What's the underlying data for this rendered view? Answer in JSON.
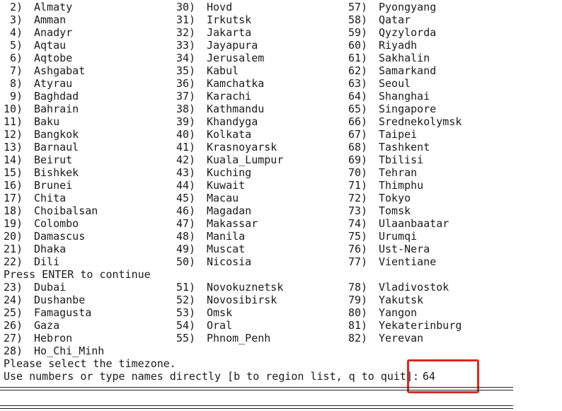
{
  "terminal": {
    "columns": [
      [
        {
          "num": " 2)",
          "name": "Almaty"
        },
        {
          "num": " 3)",
          "name": "Amman"
        },
        {
          "num": " 4)",
          "name": "Anadyr"
        },
        {
          "num": " 5)",
          "name": "Aqtau"
        },
        {
          "num": " 6)",
          "name": "Aqtobe"
        },
        {
          "num": " 7)",
          "name": "Ashgabat"
        },
        {
          "num": " 8)",
          "name": "Atyrau"
        },
        {
          "num": " 9)",
          "name": "Baghdad"
        },
        {
          "num": "10)",
          "name": "Bahrain"
        },
        {
          "num": "11)",
          "name": "Baku"
        },
        {
          "num": "12)",
          "name": "Bangkok"
        },
        {
          "num": "13)",
          "name": "Barnaul"
        },
        {
          "num": "14)",
          "name": "Beirut"
        },
        {
          "num": "15)",
          "name": "Bishkek"
        },
        {
          "num": "16)",
          "name": "Brunei"
        },
        {
          "num": "17)",
          "name": "Chita"
        },
        {
          "num": "18)",
          "name": "Choibalsan"
        },
        {
          "num": "19)",
          "name": "Colombo"
        },
        {
          "num": "20)",
          "name": "Damascus"
        },
        {
          "num": "21)",
          "name": "Dhaka"
        },
        {
          "num": "22)",
          "name": "Dili"
        }
      ],
      [
        {
          "num": "30)",
          "name": "Hovd"
        },
        {
          "num": "31)",
          "name": "Irkutsk"
        },
        {
          "num": "32)",
          "name": "Jakarta"
        },
        {
          "num": "33)",
          "name": "Jayapura"
        },
        {
          "num": "34)",
          "name": "Jerusalem"
        },
        {
          "num": "35)",
          "name": "Kabul"
        },
        {
          "num": "36)",
          "name": "Kamchatka"
        },
        {
          "num": "37)",
          "name": "Karachi"
        },
        {
          "num": "38)",
          "name": "Kathmandu"
        },
        {
          "num": "39)",
          "name": "Khandyga"
        },
        {
          "num": "40)",
          "name": "Kolkata"
        },
        {
          "num": "41)",
          "name": "Krasnoyarsk"
        },
        {
          "num": "42)",
          "name": "Kuala_Lumpur"
        },
        {
          "num": "43)",
          "name": "Kuching"
        },
        {
          "num": "44)",
          "name": "Kuwait"
        },
        {
          "num": "45)",
          "name": "Macau"
        },
        {
          "num": "46)",
          "name": "Magadan"
        },
        {
          "num": "47)",
          "name": "Makassar"
        },
        {
          "num": "48)",
          "name": "Manila"
        },
        {
          "num": "49)",
          "name": "Muscat"
        },
        {
          "num": "50)",
          "name": "Nicosia"
        }
      ],
      [
        {
          "num": "57)",
          "name": "Pyongyang"
        },
        {
          "num": "58)",
          "name": "Qatar"
        },
        {
          "num": "59)",
          "name": "Qyzylorda"
        },
        {
          "num": "60)",
          "name": "Riyadh"
        },
        {
          "num": "61)",
          "name": "Sakhalin"
        },
        {
          "num": "62)",
          "name": "Samarkand"
        },
        {
          "num": "63)",
          "name": "Seoul"
        },
        {
          "num": "64)",
          "name": "Shanghai"
        },
        {
          "num": "65)",
          "name": "Singapore"
        },
        {
          "num": "66)",
          "name": "Srednekolymsk"
        },
        {
          "num": "67)",
          "name": "Taipei"
        },
        {
          "num": "68)",
          "name": "Tashkent"
        },
        {
          "num": "69)",
          "name": "Tbilisi"
        },
        {
          "num": "70)",
          "name": "Tehran"
        },
        {
          "num": "71)",
          "name": "Thimphu"
        },
        {
          "num": "72)",
          "name": "Tokyo"
        },
        {
          "num": "73)",
          "name": "Tomsk"
        },
        {
          "num": "74)",
          "name": "Ulaanbaatar"
        },
        {
          "num": "75)",
          "name": "Urumqi"
        },
        {
          "num": "76)",
          "name": "Ust-Nera"
        },
        {
          "num": "77)",
          "name": "Vientiane"
        }
      ]
    ],
    "pause_text": "Press ENTER to continue",
    "columns2": [
      [
        {
          "num": "23)",
          "name": "Dubai"
        },
        {
          "num": "24)",
          "name": "Dushanbe"
        },
        {
          "num": "25)",
          "name": "Famagusta"
        },
        {
          "num": "26)",
          "name": "Gaza"
        },
        {
          "num": "27)",
          "name": "Hebron"
        },
        {
          "num": "28)",
          "name": "Ho_Chi_Minh"
        }
      ],
      [
        {
          "num": "51)",
          "name": "Novokuznetsk"
        },
        {
          "num": "52)",
          "name": "Novosibirsk"
        },
        {
          "num": "53)",
          "name": "Omsk"
        },
        {
          "num": "54)",
          "name": "Oral"
        },
        {
          "num": "55)",
          "name": "Phnom_Penh"
        }
      ],
      [
        {
          "num": "78)",
          "name": "Vladivostok"
        },
        {
          "num": "79)",
          "name": "Yakutsk"
        },
        {
          "num": "80)",
          "name": "Yangon"
        },
        {
          "num": "81)",
          "name": "Yekaterinburg"
        },
        {
          "num": "82)",
          "name": "Yerevan"
        }
      ]
    ],
    "select_prompt": "Please select the timezone.",
    "input_prompt": "Use numbers or type names directly [b to region list, q to quit]",
    "input_colon": ":",
    "input_value": "64"
  },
  "colors": {
    "text": "#1a1a1a",
    "background": "#ffffff",
    "highlight": "#e0271f"
  }
}
